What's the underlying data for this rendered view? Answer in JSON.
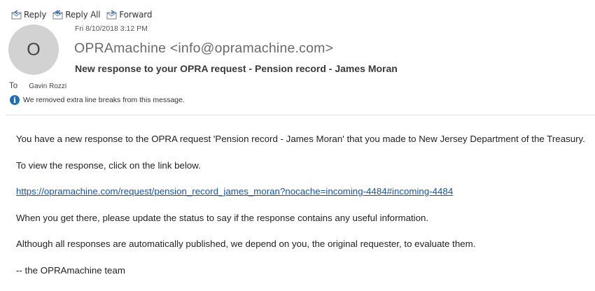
{
  "toolbar": {
    "reply": "Reply",
    "reply_all": "Reply All",
    "forward": "Forward"
  },
  "header": {
    "avatar_initial": "O",
    "date": "Fri 8/10/2018 3:12 PM",
    "sender": "OPRAmachine <info@opramachine.com>",
    "subject": "New response to your OPRA request - Pension record - James Moran",
    "to_label": "To",
    "recipient": "Gavin Rozzi",
    "notice": "We removed extra line breaks from this message."
  },
  "message": {
    "line1": "You have a new response to the OPRA request 'Pension record - James Moran' that you made to New Jersey Department of the Treasury.",
    "line2": "To view the response, click on the link below.",
    "link": "https://opramachine.com/request/pension_record_james_moran?nocache=incoming-4484#incoming-4484",
    "line3": "When you get there, please update the status to say if the response contains any useful information.",
    "line4": "Although all responses are automatically published, we depend on you, the original requester, to evaluate them.",
    "signature": "-- the OPRAmachine team"
  },
  "colors": {
    "link": "#1155aa",
    "info_icon": "#1f6fb2",
    "avatar_bg": "#d2d2d2"
  },
  "icons": [
    "reply-icon",
    "reply-all-icon",
    "forward-icon",
    "info-icon"
  ]
}
